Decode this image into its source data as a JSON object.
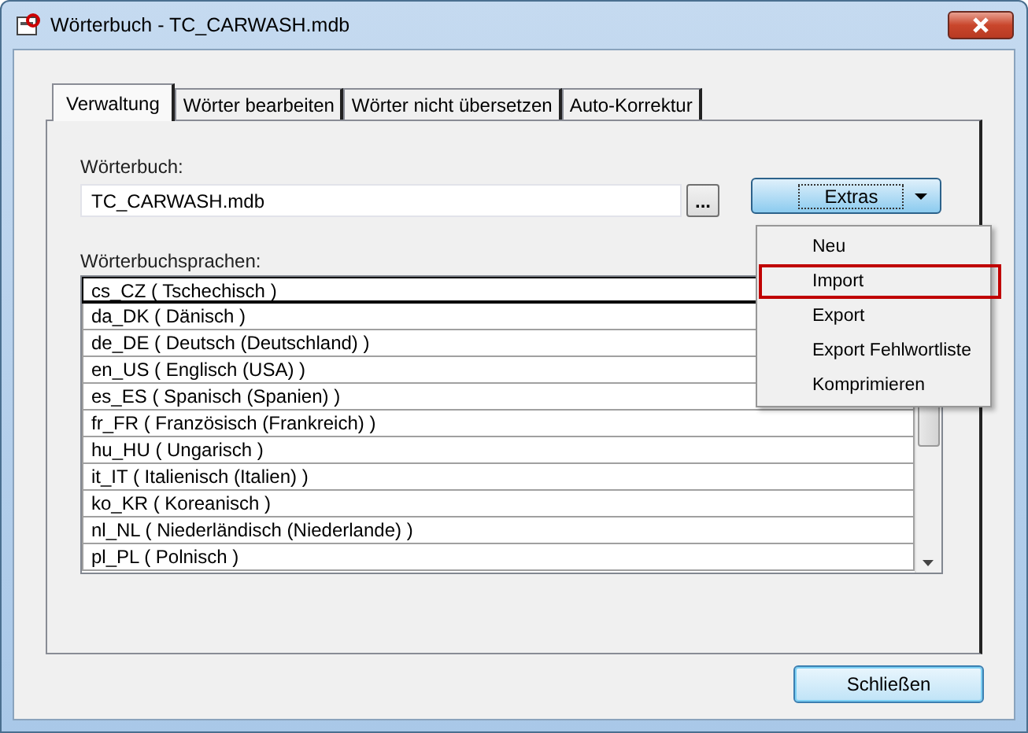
{
  "window": {
    "title": "Wörterbuch - TC_CARWASH.mdb"
  },
  "tabs": [
    {
      "label": "Verwaltung",
      "selected": true
    },
    {
      "label": "Wörter bearbeiten",
      "selected": false
    },
    {
      "label": "Wörter nicht übersetzen",
      "selected": false
    },
    {
      "label": "Auto-Korrektur",
      "selected": false
    }
  ],
  "dictionary": {
    "label": "Wörterbuch:",
    "value": "TC_CARWASH.mdb",
    "browse_button": "..."
  },
  "extras_button": {
    "label": "Extras",
    "expanded": true
  },
  "extras_menu": [
    {
      "label": "Neu",
      "highlighted": false
    },
    {
      "label": "Import",
      "highlighted": true
    },
    {
      "label": "Export",
      "highlighted": false
    },
    {
      "label": "Export Fehlwortliste",
      "highlighted": false
    },
    {
      "label": "Komprimieren",
      "highlighted": false
    }
  ],
  "languages": {
    "label": "Wörterbuchsprachen:",
    "items": [
      {
        "label": "cs_CZ ( Tschechisch )",
        "selected": true
      },
      {
        "label": "da_DK ( Dänisch )",
        "selected": false
      },
      {
        "label": "de_DE ( Deutsch (Deutschland) )",
        "selected": false
      },
      {
        "label": "en_US ( Englisch (USA) )",
        "selected": false
      },
      {
        "label": "es_ES ( Spanisch (Spanien) )",
        "selected": false
      },
      {
        "label": "fr_FR ( Französisch (Frankreich) )",
        "selected": false
      },
      {
        "label": "hu_HU ( Ungarisch )",
        "selected": false
      },
      {
        "label": "it_IT ( Italienisch (Italien) )",
        "selected": false
      },
      {
        "label": "ko_KR ( Koreanisch )",
        "selected": false
      },
      {
        "label": "nl_NL ( Niederländisch (Niederlande) )",
        "selected": false
      },
      {
        "label": "pl_PL ( Polnisch )",
        "selected": false
      }
    ]
  },
  "close_button": "Schließen"
}
